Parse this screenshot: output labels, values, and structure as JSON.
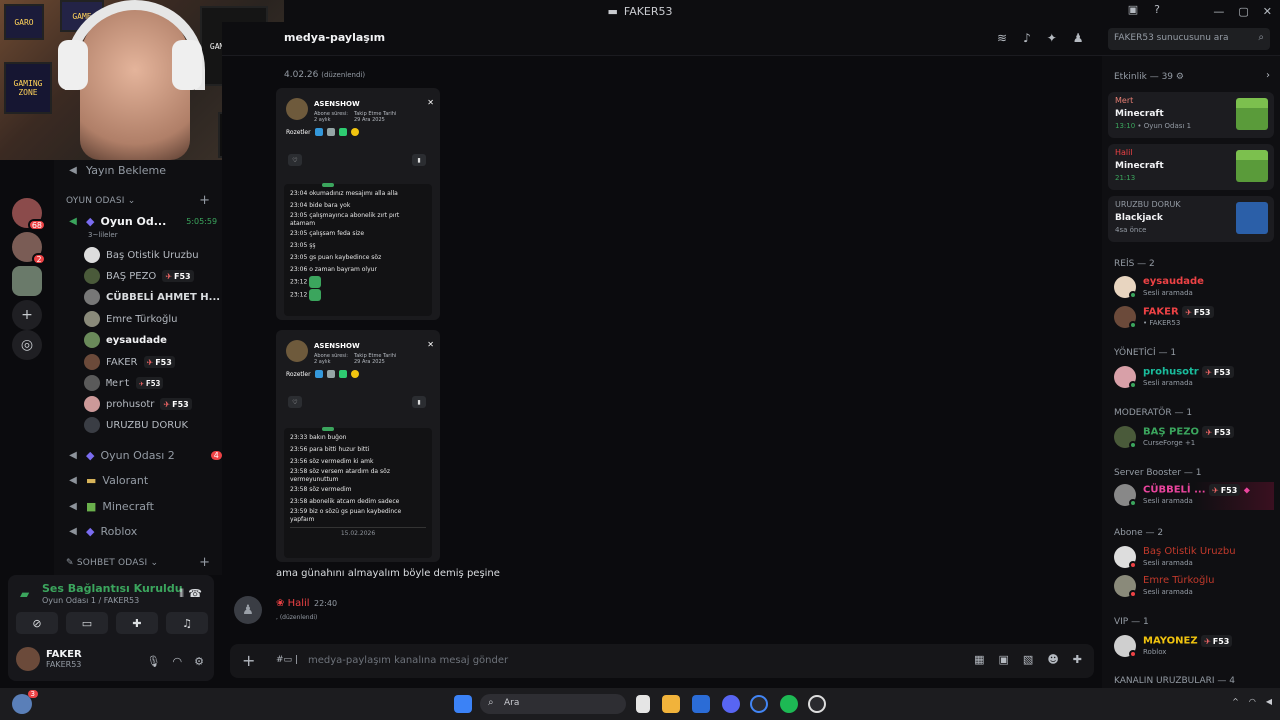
{
  "window": {
    "title": "FAKER53",
    "controls": [
      "—",
      "▢",
      "✕"
    ]
  },
  "colors": {
    "online": "#3ba55d",
    "danger": "#ed4245",
    "accent": "#5865f2"
  },
  "rail": {
    "servers": [
      {
        "badge": "68"
      },
      {
        "badge": "2"
      },
      {
        "badge": ""
      }
    ],
    "add_icon": "plus-icon",
    "explore_icon": "compass-icon"
  },
  "channels": {
    "top_item": "Yayın Bekleme",
    "category_game": "OYUN ODASI",
    "active_channel": "Oyun Od...",
    "active_timer": "5:05:59",
    "active_sub": "3~lileler",
    "voice_members": [
      {
        "name": "Baş Otistik Uruzbu",
        "tag": ""
      },
      {
        "name": "BAŞ PEZO",
        "tag": "F53"
      },
      {
        "name": "CÜBBELİ AHMET H...",
        "tag": ""
      },
      {
        "name": "Emre Türkoğlu",
        "tag": ""
      },
      {
        "name": "eysaudade",
        "tag": ""
      },
      {
        "name": "FAKER",
        "tag": "F53"
      },
      {
        "name": "Mert",
        "tag": "F53"
      },
      {
        "name": "prohusotr",
        "tag": "F53"
      },
      {
        "name": "URUZBU DORUK",
        "tag": ""
      }
    ],
    "other_channels": [
      {
        "name": "Oyun Odası 2",
        "badge": "4"
      },
      {
        "name": "Valorant",
        "badge": ""
      },
      {
        "name": "Minecraft",
        "badge": ""
      },
      {
        "name": "Roblox",
        "badge": ""
      }
    ],
    "category_chat": "SOHBET ODASI"
  },
  "voice_panel": {
    "status": "Ses Bağlantısı Kuruldu",
    "location": "Oyun Odası 1 / FAKER53",
    "user_name": "FAKER",
    "user_status": "FAKER53"
  },
  "header": {
    "channel_name": "medya-paylaşım",
    "search_placeholder": "FAKER53 sunucusunu ara"
  },
  "chat": {
    "date_fragment": "4.02.26",
    "edited_label": "(düzenlendi)",
    "cards": [
      {
        "name": "ASENSHOW",
        "sub_label": "Abone süresi:",
        "sub_value": "2 aylık",
        "follow_label": "Takip Etme Tarihi",
        "follow_value": "29 Ara 2025",
        "badges_label": "Rozetler",
        "lines": [
          "23:04 okumadınız mesajımı alla alla",
          "23:04 bide bara yok",
          "23:05 çalışmayınca abonelik zırt pırt atamam",
          "23:05 çalışsam feda size",
          "23:05 şş",
          "23:05 gs puan kaybedince söz",
          "23:06 o zaman bayram olyur",
          "23:12",
          "23:12"
        ],
        "footer_date": ""
      },
      {
        "name": "ASENSHOW",
        "sub_label": "Abone süresi:",
        "sub_value": "2 aylık",
        "follow_label": "Takip Etme Tarihi",
        "follow_value": "29 Ara 2025",
        "badges_label": "Rozetler",
        "lines": [
          "23:33 bakın buğon",
          "23:56 para bitti huzur bitti",
          "23:56 söz vermedim ki amk",
          "23:58 söz versem atardım da söz vermeyunuttum",
          "23:58 söz vermedim",
          "23:58 abonelik atcam dedim sadece",
          "23:59 biz o sözü gs puan kaybedince yapfaım"
        ],
        "footer_date": "15.02.2026"
      }
    ],
    "message_text": "ama günahını almayalım böyle demiş peşine",
    "second_author": "Halil",
    "second_time": "22:40",
    "composer_placeholder": "medya-paylaşım kanalına mesaj gönder"
  },
  "members": {
    "activity_header": "Etkinlik — 39",
    "activities": [
      {
        "who": "Mert",
        "game": "Minecraft",
        "time": "13:10",
        "extra": "• Oyun Odası 1",
        "thumb_color": "#5a9b3a"
      },
      {
        "who": "Halil",
        "game": "Minecraft",
        "time": "21:13",
        "extra": "",
        "thumb_color": "#5a9b3a"
      },
      {
        "who": "URUZBU DORUK",
        "game": "Blackjack",
        "time": "4sa önce",
        "extra": "",
        "thumb_color": "#2b5fa8"
      }
    ],
    "groups": [
      {
        "title": "REİS — 2",
        "people": [
          {
            "name": "eysaudade",
            "status": "Sesli aramada",
            "color": "#ed4245",
            "tag": ""
          },
          {
            "name": "FAKER",
            "status": "• FAKER53",
            "color": "#ed4245",
            "tag": "F53"
          }
        ]
      },
      {
        "title": "YÖNETİCİ — 1",
        "people": [
          {
            "name": "prohusotr",
            "status": "Sesli aramada",
            "color": "#1abc9c",
            "tag": "F53"
          }
        ]
      },
      {
        "title": "MODERATÖR — 1",
        "people": [
          {
            "name": "BAŞ PEZO",
            "status": "CurseForge +1",
            "color": "#3ba55d",
            "tag": "F53"
          }
        ]
      },
      {
        "title": "Server Booster — 1",
        "people": [
          {
            "name": "CÜBBELİ ...",
            "status": "Sesli aramada",
            "color": "#eb459e",
            "tag": "F53"
          }
        ]
      },
      {
        "title": "Abone — 2",
        "people": [
          {
            "name": "Baş Otistik Uruzbu",
            "status": "Sesli aramada",
            "color": "#c0392b",
            "tag": ""
          },
          {
            "name": "Emre Türkoğlu",
            "status": "Sesli aramada",
            "color": "#c0392b",
            "tag": ""
          }
        ]
      },
      {
        "title": "VIP — 1",
        "people": [
          {
            "name": "MAYONEZ",
            "status": "Roblox",
            "color": "#f1c40f",
            "tag": "F53"
          }
        ]
      },
      {
        "title": "KANALIN URUZBULARI — 4",
        "people": []
      }
    ]
  },
  "taskbar": {
    "search_placeholder": "Ara",
    "notif_badge": "3"
  }
}
